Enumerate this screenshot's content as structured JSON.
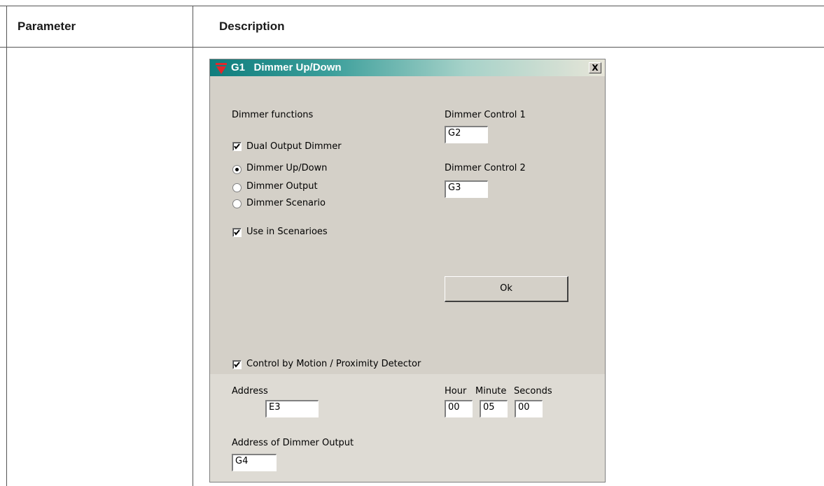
{
  "table": {
    "col_parameter": "Parameter",
    "col_description": "Description"
  },
  "dialog": {
    "title": "G1   Dimmer Up/Down",
    "title_icon": "red-down-triangle-icon",
    "close_label": "X",
    "dimmer_functions_label": "Dimmer functions",
    "dual_output_label": "Dual Output Dimmer",
    "dual_output_checked": true,
    "radio_up_down": "Dimmer Up/Down",
    "radio_output": "Dimmer Output",
    "radio_scenario": "Dimmer Scenario",
    "selected_radio": "Dimmer Up/Down",
    "use_in_scenarios_label": "Use in Scenarioes",
    "use_in_scenarios_checked": true,
    "dimmer_control_1_label": "Dimmer Control 1",
    "dimmer_control_1_value": "G2",
    "dimmer_control_2_label": "Dimmer Control 2",
    "dimmer_control_2_value": "G3",
    "ok_label": "Ok",
    "motion_label": "Control by Motion / Proximity Detector",
    "motion_checked": true,
    "address_label": "Address",
    "address_value": "E3",
    "hour_label": "Hour",
    "minute_label": "Minute",
    "seconds_label": "Seconds",
    "hour_value": "00",
    "minute_value": "05",
    "seconds_value": "00",
    "address_dimmer_output_label": "Address of Dimmer Output",
    "address_dimmer_output_value": "G4"
  },
  "colors": {
    "dialog_bg": "#d4d0c8",
    "title_gradient_start": "#0f7d7d",
    "title_gradient_end": "#e7e5d8",
    "icon_red": "#e3262a"
  }
}
